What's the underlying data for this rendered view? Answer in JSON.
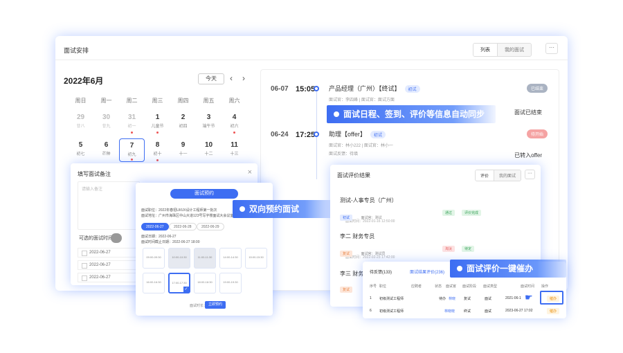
{
  "window": {
    "title": "面试安排",
    "seg_active": "列表",
    "seg_other": "我的面试",
    "more": "···"
  },
  "calendar": {
    "month": "2022年6月",
    "today": "今天",
    "prev": "‹",
    "next": "›",
    "weekdays": [
      "周日",
      "周一",
      "周二",
      "周三",
      "周四",
      "周五",
      "周六"
    ],
    "days": [
      {
        "n": "29",
        "l": "廿八",
        "dim": true
      },
      {
        "n": "30",
        "l": "廿九",
        "dim": true
      },
      {
        "n": "31",
        "l": "初一",
        "dim": true,
        "dot": true
      },
      {
        "n": "1",
        "l": "儿童节",
        "dot": true
      },
      {
        "n": "2",
        "l": "初四"
      },
      {
        "n": "3",
        "l": "端午节",
        "dot": false
      },
      {
        "n": "4",
        "l": "初六",
        "dot": true
      },
      {
        "n": "5",
        "l": "初七"
      },
      {
        "n": "6",
        "l": "芒种"
      },
      {
        "n": "7",
        "l": "初九",
        "sel": true,
        "dot": true
      },
      {
        "n": "8",
        "l": "初十",
        "dot": true
      },
      {
        "n": "9",
        "l": "十一"
      },
      {
        "n": "10",
        "l": "十二"
      },
      {
        "n": "11",
        "l": "十三"
      }
    ]
  },
  "schedule": {
    "events": [
      {
        "date": "06-07",
        "time": "15:05",
        "title": "产品经理（广州）【终试】",
        "tag": "初试",
        "status": "已结束",
        "meta": "面试官：李四峰 | 面试官：面试方面",
        "action": "面试已结束"
      },
      {
        "date": "06-24",
        "time": "17:25",
        "title": "助理【offer】",
        "tag": "初试",
        "status": "待开始",
        "meta": "面试官：林小222 | 面试官：林小一",
        "meta2": "面试反馈：待填",
        "action": "已转入offer"
      }
    ]
  },
  "banners": {
    "sync": "面试日程、签到、评价等信息自动同步",
    "booking": "双向预约面试",
    "urge": "面试评价一键催办"
  },
  "note": {
    "title": "填写面试备注",
    "close": "×",
    "placeholder": "请输入备注",
    "label": "可选的面试时间",
    "rows": [
      "2022-06-27",
      "2022-06-27",
      "2022-06-27"
    ]
  },
  "booking": {
    "title": "面试预约",
    "line1": "面试职位：2022年春招UI/UX设计工程师第一批次",
    "line2": "面试地址：广州市海珠区中山大道123号写字楼面试大会议室",
    "tabs": [
      "2022-06-27",
      "2022-06-28",
      "2022-06-29"
    ],
    "line3": "面试日期：2022-06-27",
    "line4": "面试时间截止日期：2022-06-27 18:00",
    "slots": [
      {
        "t": "09:00-09:30",
        "state": "free"
      },
      {
        "t": "10:00-10:30",
        "state": "busy"
      },
      {
        "t": "11:00-11:30",
        "state": "busy"
      },
      {
        "t": "14:00-14:30",
        "state": "free"
      },
      {
        "t": "15:00-15:30",
        "state": "free"
      },
      {
        "t": "16:00-16:30",
        "state": "free"
      },
      {
        "t": "17:00-17:30",
        "state": "sel"
      },
      {
        "t": "18:00-18:30",
        "state": "free"
      },
      {
        "t": "19:00-19:30",
        "state": "free"
      }
    ],
    "foot": "面试时长：",
    "confirm": "立即预约"
  },
  "eval": {
    "title": "面试评价结果",
    "seg_active": "评价",
    "seg_other": "我的面试",
    "more": "···",
    "cards": [
      {
        "name": "测试-人事专员（广州）",
        "tag1": "初试",
        "sub": "面试官：测试",
        "b1": "通过",
        "b2": "评价完成",
        "time": "面试时间：2022-01-16 12:50:00"
      },
      {
        "name": "李二  财务专员",
        "tag1": "复试",
        "sub": "面试官：测试员",
        "b1": "淘汰",
        "b2": "待定",
        "time": "面试时间：2022-02-23 17:42:00"
      },
      {
        "name": "李三  财务专员",
        "tag1": "复试",
        "sub": "",
        "b1": "",
        "b2": "",
        "time": ""
      }
    ]
  },
  "list": {
    "tab_on": "待反馈(133)",
    "tab_off": "面试结果评价(236)",
    "headers": [
      "序号",
      "职位",
      "应聘者",
      "状态",
      "面试官",
      "面试阶段",
      "面试类型",
      "面试时间",
      "操作"
    ],
    "rows": [
      {
        "no": "1",
        "pos": "初级测试工程师",
        "who": "",
        "st": "待办",
        "hr": "林晓",
        "stage": "复试",
        "type": "面试",
        "time": "2021-06-1",
        "op": "催办"
      },
      {
        "no": "6",
        "pos": "初级测试工程师",
        "who": "",
        "st": "",
        "hr": "林晓晓",
        "stage": "终试",
        "type": "面试",
        "time": "2023-06-27 17:02",
        "op": "催办"
      }
    ]
  }
}
